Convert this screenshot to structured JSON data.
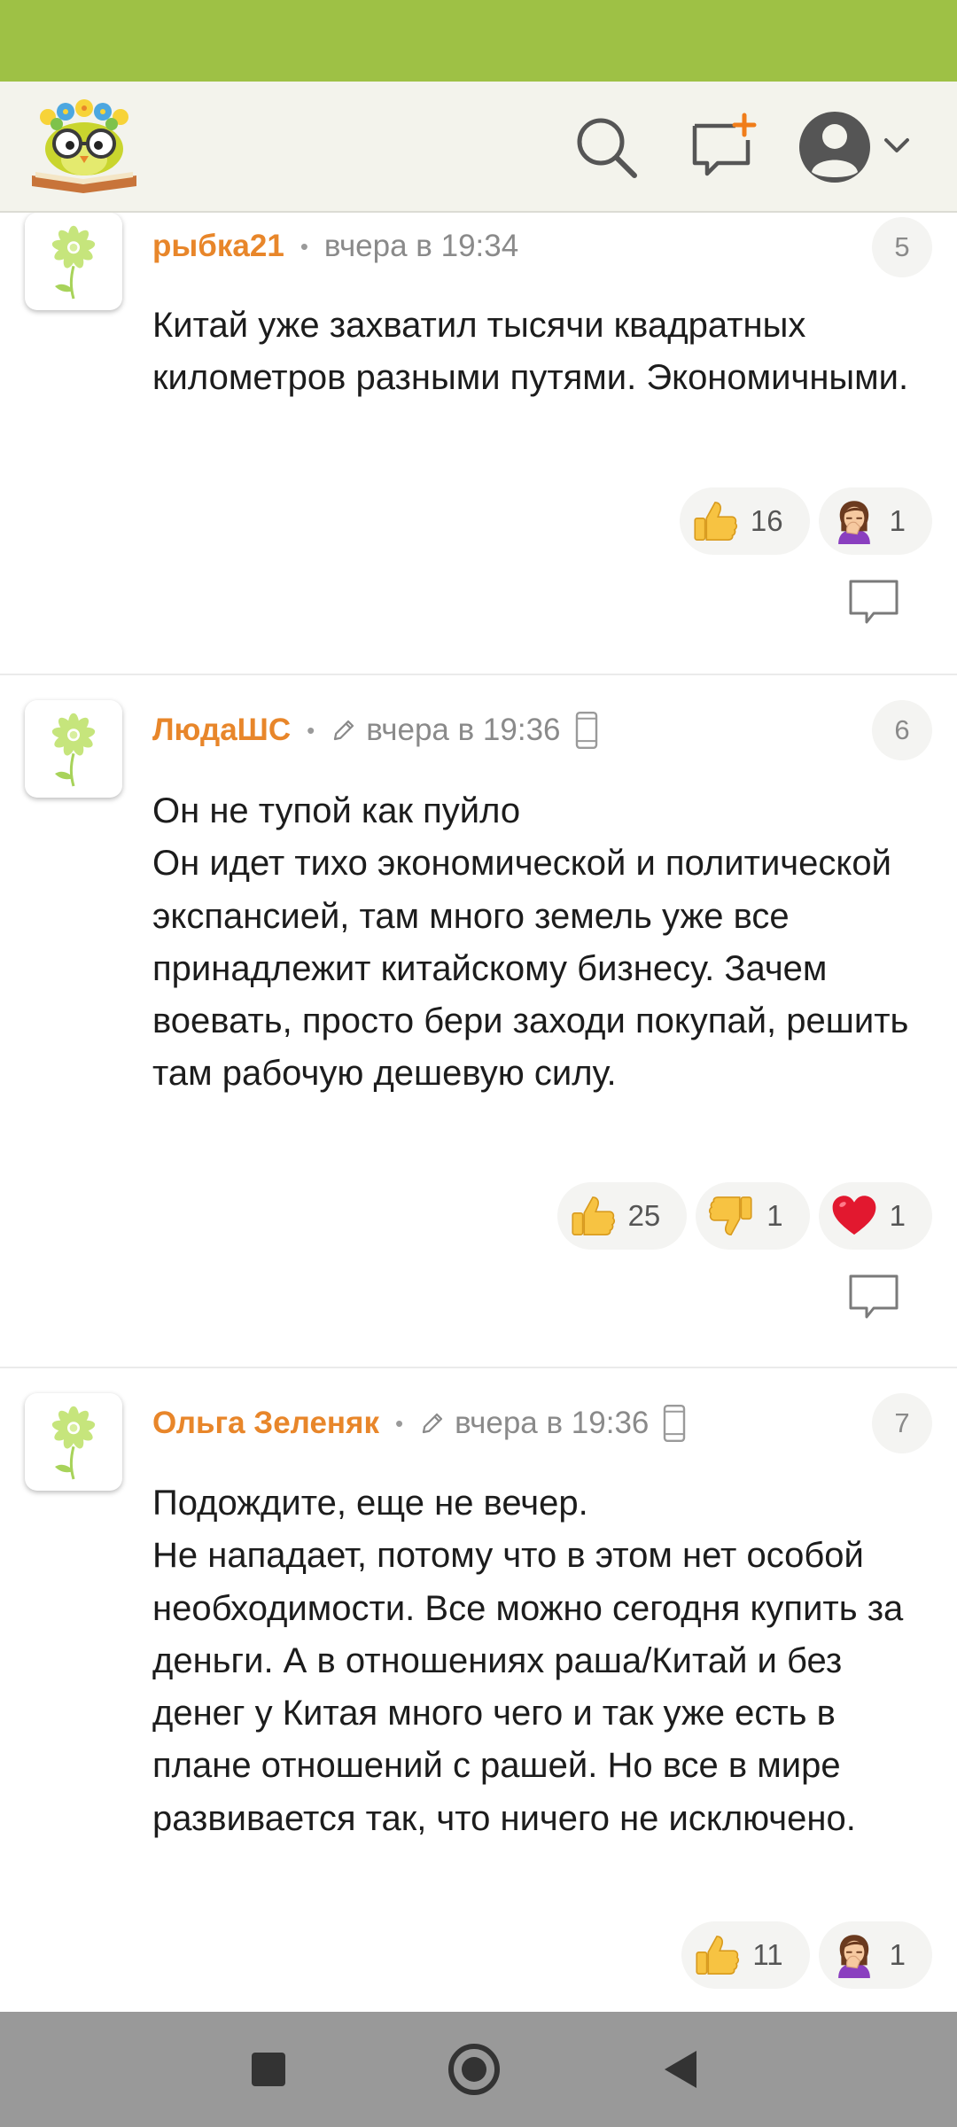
{
  "app": {
    "logo_icon": "owl-with-flowers-on-book-logo",
    "toolbar_icons": [
      "search-icon",
      "new-post-icon",
      "profile-avatar-icon",
      "chevron-down-icon"
    ]
  },
  "colors": {
    "status_bar": "#9ec145",
    "toolbar_bg": "#f3f3ec",
    "author": "#e8862a",
    "nav_bar": "#999999"
  },
  "comments": [
    {
      "author": "рыбка21",
      "time": "вчера в 19:34",
      "number": "5",
      "text": "Китай уже захватил тысячи квадратных километров разными путями. Экономичными.",
      "reactions": [
        {
          "icon": "thumbs-up-icon",
          "count": "16"
        },
        {
          "icon": "facepalm-icon",
          "count": "1"
        }
      ]
    },
    {
      "author": "ЛюдаШС",
      "time": "вчера в 19:36",
      "edited_icon": "pencil-icon",
      "device_icon": "mobile-phone-icon",
      "number": "6",
      "text": "Он не тупой как пуйло\nОн идет тихо экономической и политической экспансией, там много земель уже все принадлежит китайскому бизнесу. Зачем воевать, просто бери заходи покупай, решить там рабочую дешевую силу.",
      "reactions": [
        {
          "icon": "thumbs-up-icon",
          "count": "25"
        },
        {
          "icon": "thumbs-down-icon",
          "count": "1"
        },
        {
          "icon": "heart-icon",
          "count": "1"
        }
      ]
    },
    {
      "author": "Ольга Зеленяк",
      "time": "вчера в 19:36",
      "edited_icon": "pencil-icon",
      "device_icon": "mobile-phone-icon",
      "number": "7",
      "text": "Подождите, еще не вечер.\nНе нападает, потому что в этом нет особой необходимости. Все можно сегодня купить за деньги. А в отношениях раша/Китай и без денег у Китая много чего и так уже есть в плане отношений с рашей. Но все в мире развивается так, что ничего не исключено.",
      "reactions": [
        {
          "icon": "thumbs-up-icon",
          "count": "11"
        },
        {
          "icon": "facepalm-icon",
          "count": "1"
        }
      ]
    }
  ],
  "navigation_bar": {
    "buttons": [
      "recents-square-icon",
      "home-circle-icon",
      "back-triangle-icon"
    ]
  }
}
